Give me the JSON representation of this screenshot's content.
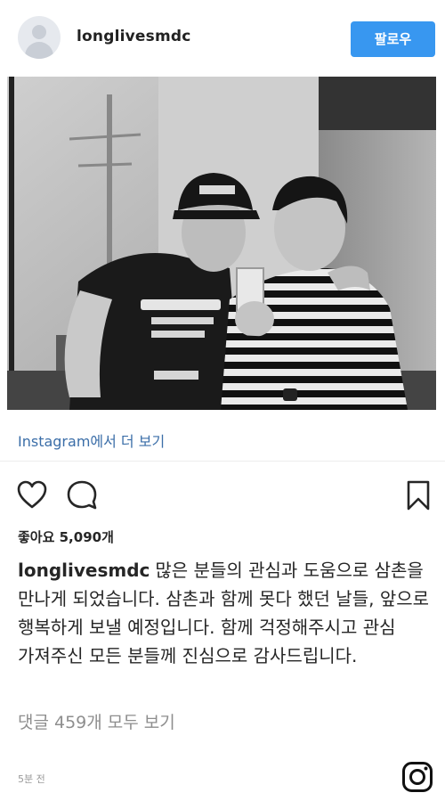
{
  "header": {
    "username": "longlivesmdc",
    "follow_label": "팔로우"
  },
  "photo": {
    "cap_text": "A6OVE",
    "shirt_text_1": "STUSSY",
    "shirt_text_2": "NEW YEL",
    "shirt_text_3": "TOKYO",
    "shirt_text_4": "LONDON"
  },
  "view_more": {
    "label": "Instagram에서 더 보기"
  },
  "actions": {
    "icons": [
      "heart-icon",
      "comment-icon",
      "bookmark-icon"
    ]
  },
  "likes": {
    "label": "좋아요 5,090개"
  },
  "caption": {
    "username": "longlivesmdc",
    "text": "많은 분들의 관심과 도움으로 삼촌을 만나게 되었습니다. 삼촌과 함께 못다 했던 날들, 앞으로 행복하게 보낼 예정입니다. 함께 걱정해주시고 관심 가져주신 모든 분들께 진심으로 감사드립니다."
  },
  "comments": {
    "label": "댓글 459개 모두 보기"
  },
  "footer": {
    "time": "5분 전"
  },
  "colors": {
    "accent": "#3897f0",
    "link": "#3b6ea8",
    "muted": "#8e8e8e"
  }
}
